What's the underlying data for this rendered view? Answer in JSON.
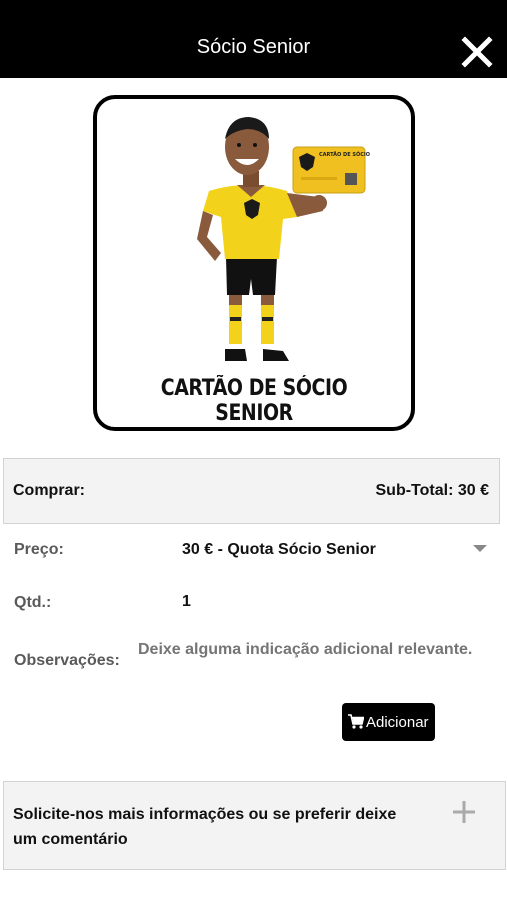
{
  "header": {
    "title": "Sócio Senior",
    "close_icon": "close-icon"
  },
  "product": {
    "image_caption": "CARTÃO DE SÓCIO SENIOR",
    "card_text": "CARTÃO DE SÓCIO",
    "colors": {
      "jersey": "#f2d21a",
      "card": "#f0c020",
      "shorts": "#111111"
    }
  },
  "purchase": {
    "label": "Comprar:",
    "subtotal": "Sub-Total: 30 €"
  },
  "form": {
    "price_label": "Preço:",
    "price_value": "30 € - Quota Sócio Senior",
    "qty_label": "Qtd.:",
    "qty_value": "1",
    "notes_label": "Observações:",
    "notes_placeholder": "Deixe alguma indicação adicional relevante."
  },
  "actions": {
    "add_label": "Adicionar",
    "add_icon": "cart-icon"
  },
  "info": {
    "text": "Solicite-nos mais informações ou se preferir deixe um comentário",
    "toggle_icon": "plus-icon"
  }
}
